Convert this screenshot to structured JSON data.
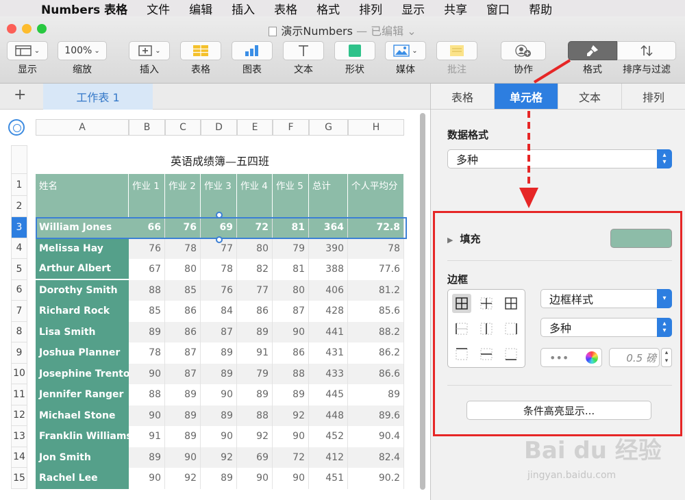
{
  "menubar": {
    "apple": "",
    "items": [
      "Numbers 表格",
      "文件",
      "编辑",
      "插入",
      "表格",
      "格式",
      "排列",
      "显示",
      "共享",
      "窗口",
      "帮助"
    ]
  },
  "window": {
    "title": "演示Numbers",
    "edited": "— 已编辑 ⌄"
  },
  "toolbar": {
    "display": "显示",
    "zoom_value": "100%",
    "zoom": "缩放",
    "insert": "插入",
    "table": "表格",
    "chart": "图表",
    "text": "文本",
    "shape": "形状",
    "media": "媒体",
    "comment": "批注",
    "collaborate": "协作",
    "format": "格式",
    "sort_filter": "排序与过滤"
  },
  "sheet_tabs": {
    "add": "+",
    "active": "工作表 1"
  },
  "inspector": {
    "tabs": [
      "表格",
      "单元格",
      "文本",
      "排列"
    ],
    "data_format_label": "数据格式",
    "data_format_value": "多种",
    "fill_label": "填充",
    "fill_color": "#8dbca8",
    "border_label": "边框",
    "border_style_value": "边框样式",
    "border_type_value": "多种",
    "border_dots": "•••",
    "border_width": "0.5 磅",
    "conditional_highlight": "条件高亮显示..."
  },
  "table": {
    "title": "英语成绩簿—五四班",
    "columns": [
      "A",
      "B",
      "C",
      "D",
      "E",
      "F",
      "G",
      "H"
    ],
    "header_row": [
      "姓名",
      "作业 1",
      "作业 2",
      "作业 3",
      "作业 4",
      "作业 5",
      "总计",
      "个人平均分"
    ],
    "row_numbers": [
      "1",
      "2",
      "3",
      "4",
      "5",
      "6",
      "7",
      "8",
      "9",
      "10",
      "11",
      "12",
      "13",
      "14",
      "15"
    ],
    "selected_row": 3,
    "rows": [
      {
        "name": "William Jones",
        "values": [
          "66",
          "76",
          "69",
          "72",
          "81",
          "364",
          "72.8"
        ]
      },
      {
        "name": "Melissa Hay",
        "values": [
          "76",
          "78",
          "77",
          "80",
          "79",
          "390",
          "78"
        ]
      },
      {
        "name": "Arthur Albert",
        "values": [
          "67",
          "80",
          "78",
          "82",
          "81",
          "388",
          "77.6"
        ]
      },
      {
        "name": "Dorothy Smith",
        "values": [
          "88",
          "85",
          "76",
          "77",
          "80",
          "406",
          "81.2"
        ]
      },
      {
        "name": "Richard Rock",
        "values": [
          "85",
          "86",
          "84",
          "86",
          "87",
          "428",
          "85.6"
        ]
      },
      {
        "name": "Lisa Smith",
        "values": [
          "89",
          "86",
          "87",
          "89",
          "90",
          "441",
          "88.2"
        ]
      },
      {
        "name": "Joshua Planner",
        "values": [
          "78",
          "87",
          "89",
          "91",
          "86",
          "431",
          "86.2"
        ]
      },
      {
        "name": "Josephine Trenton",
        "values": [
          "90",
          "87",
          "89",
          "79",
          "88",
          "433",
          "86.6"
        ]
      },
      {
        "name": "Jennifer Ranger",
        "values": [
          "88",
          "89",
          "90",
          "89",
          "89",
          "445",
          "89"
        ]
      },
      {
        "name": "Michael Stone",
        "values": [
          "90",
          "89",
          "89",
          "88",
          "92",
          "448",
          "89.6"
        ]
      },
      {
        "name": "Franklin Williams",
        "values": [
          "91",
          "89",
          "90",
          "92",
          "90",
          "452",
          "90.4"
        ]
      },
      {
        "name": "Jon Smith",
        "values": [
          "89",
          "90",
          "92",
          "69",
          "72",
          "412",
          "82.4"
        ]
      },
      {
        "name": "Rachel Lee",
        "values": [
          "90",
          "92",
          "89",
          "90",
          "90",
          "451",
          "90.2"
        ]
      }
    ]
  },
  "colors": {
    "accent": "#2d7ee0",
    "header_green": "#8dbca8",
    "name_green": "#55a08a",
    "annotation_red": "#e62626"
  },
  "watermark": {
    "logo": "Bai du 经验",
    "url": "jingyan.baidu.com"
  }
}
